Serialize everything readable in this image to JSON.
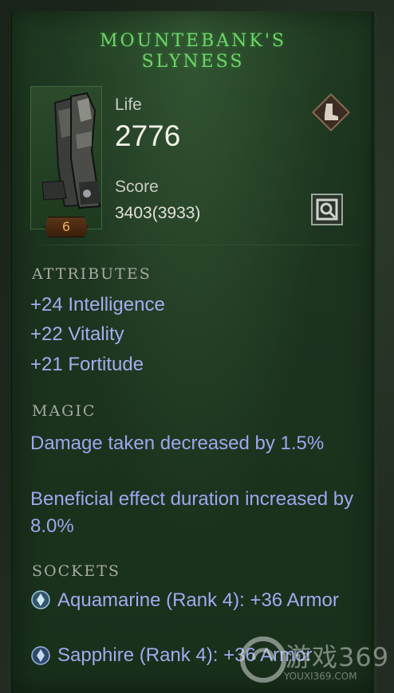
{
  "item": {
    "name_line1": "MOUNTEBANK'S",
    "name_line2": "SLYNESS",
    "rank": "6"
  },
  "stats": {
    "life_label": "Life",
    "life_value": "2776",
    "score_label": "Score",
    "score_value": "3403(3933)"
  },
  "icons": {
    "slot": "boots-slot-icon",
    "compare": "compare-icon"
  },
  "sections": {
    "attributes_header": "ATTRIBUTES",
    "attributes": [
      "+24 Intelligence",
      "+22 Vitality",
      "+21 Fortitude"
    ],
    "magic_header": "MAGIC",
    "magic": [
      "Damage taken decreased by 1.5%",
      "Beneficial effect duration increased by 8.0%"
    ],
    "sockets_header": "SOCKETS",
    "sockets": [
      "Aquamarine (Rank 4): +36 Armor",
      "Sapphire (Rank 4): +36 Armor"
    ]
  },
  "watermark": {
    "brand": "游戏369",
    "url": "YOUXI369.COM"
  },
  "colors": {
    "title": "#6fd66a",
    "attribute_text": "#a5acf0",
    "rank_badge": "#e9b35a",
    "panel": "#1c331e"
  }
}
